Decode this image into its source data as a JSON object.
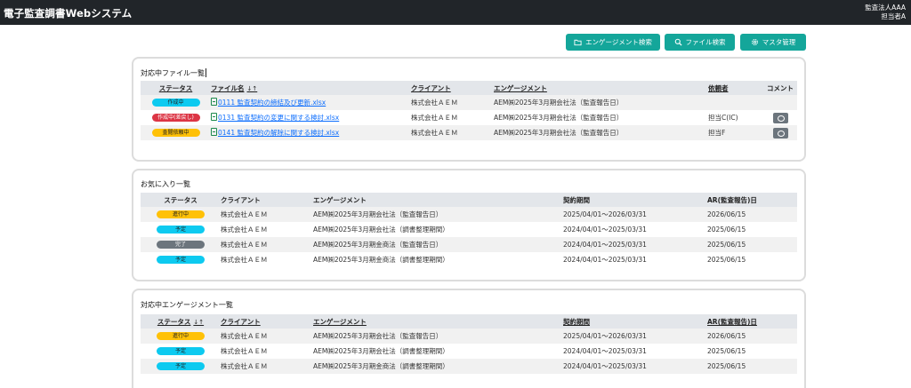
{
  "header": {
    "title": "電子監査調書Webシステム",
    "org": "監査法人AAA",
    "user": "担当者A"
  },
  "toolbar": {
    "engagement_search": "エンゲージメント検索",
    "file_search": "ファイル検索",
    "master": "マスタ管理"
  },
  "files": {
    "title": "対応中ファイル一覧",
    "headers": [
      "ステータス",
      "ファイル名",
      "クライアント",
      "エンゲージメント",
      "依頼者",
      "コメント"
    ],
    "sort_icon": "↓↑",
    "rows": [
      {
        "status": "作成中",
        "status_color": "#0dcaf0",
        "file": "0111 監査契約の締結及び更新.xlsx",
        "client": "株式会社ＡＥＭ",
        "engagement": "AEM㈱2025年3月期会社法（監査報告日）",
        "requester": "",
        "comment": false
      },
      {
        "status": "作成中(差戻し)",
        "status_color": "#dc3545",
        "file": "0131 監査契約の変更に関する検討.xlsx",
        "client": "株式会社ＡＥＭ",
        "engagement": "AEM㈱2025年3月期会社法（監査報告日）",
        "requester": "担当C(IC)",
        "comment": true
      },
      {
        "status": "査閲依頼中",
        "status_color": "#ffc107",
        "file": "0141 監査契約の解除に関する検討.xlsx",
        "client": "株式会社ＡＥＭ",
        "engagement": "AEM㈱2025年3月期会社法（監査報告日）",
        "requester": "担当F",
        "comment": true
      }
    ]
  },
  "favorites": {
    "title": "お気に入り一覧",
    "headers": [
      "ステータス",
      "クライアント",
      "エンゲージメント",
      "契約期間",
      "AR(監査報告)日"
    ],
    "rows": [
      {
        "status": "進行中",
        "status_color": "#ffc107",
        "client": "株式会社ＡＥＭ",
        "engagement": "AEM㈱2025年3月期会社法（監査報告日）",
        "period": "2025/04/01～2026/03/31",
        "ar": "2026/06/15"
      },
      {
        "status": "予定",
        "status_color": "#0dcaf0",
        "client": "株式会社ＡＥＭ",
        "engagement": "AEM㈱2025年3月期会社法（調書整理期間）",
        "period": "2024/04/01～2025/03/31",
        "ar": "2025/06/15"
      },
      {
        "status": "完了",
        "status_color": "#6c757d",
        "client": "株式会社ＡＥＭ",
        "engagement": "AEM㈱2025年3月期金商法（監査報告日）",
        "period": "2024/04/01～2025/03/31",
        "ar": "2025/06/15"
      },
      {
        "status": "予定",
        "status_color": "#0dcaf0",
        "client": "株式会社ＡＥＭ",
        "engagement": "AEM㈱2025年3月期金商法（調書整理期間）",
        "period": "2024/04/01～2025/03/31",
        "ar": "2025/06/15"
      }
    ]
  },
  "engagements": {
    "title": "対応中エンゲージメント一覧",
    "headers": [
      "ステータス",
      "クライアント",
      "エンゲージメント",
      "契約期間",
      "AR(監査報告)日"
    ],
    "sort_icon": "↓↑",
    "rows": [
      {
        "status": "進行中",
        "status_color": "#ffc107",
        "client": "株式会社ＡＥＭ",
        "engagement": "AEM㈱2025年3月期会社法（監査報告日）",
        "period": "2025/04/01～2026/03/31",
        "ar": "2026/06/15"
      },
      {
        "status": "予定",
        "status_color": "#0dcaf0",
        "client": "株式会社ＡＥＭ",
        "engagement": "AEM㈱2025年3月期会社法（調書整理期間）",
        "period": "2024/04/01～2025/03/31",
        "ar": "2025/06/15"
      },
      {
        "status": "予定",
        "status_color": "#0dcaf0",
        "client": "株式会社ＡＥＭ",
        "engagement": "AEM㈱2025年3月期金商法（調書整理期間）",
        "period": "2024/04/01～2025/03/31",
        "ar": "2025/06/15"
      }
    ]
  }
}
